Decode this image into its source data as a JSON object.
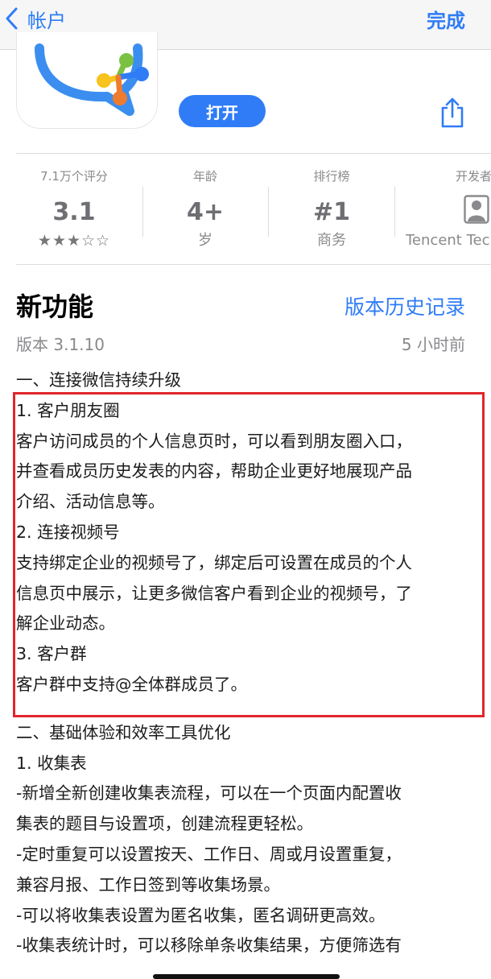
{
  "nav": {
    "back_label": "帐户",
    "done_label": "完成"
  },
  "app": {
    "open_label": "打开"
  },
  "info": {
    "ratings": {
      "label": "7.1万个评分",
      "value": "3.1",
      "stars": "★★★☆☆"
    },
    "age": {
      "label": "年龄",
      "value": "4+",
      "sub": "岁"
    },
    "chart": {
      "label": "排行榜",
      "value": "#1",
      "sub": "商务"
    },
    "developer": {
      "label": "开发者",
      "sub": "Tencent Technology"
    }
  },
  "whats_new": {
    "title": "新功能",
    "history_link": "版本历史记录",
    "version": "版本 3.1.10",
    "time_ago": "5 小时前",
    "lines_part1": [
      "一、连接微信持续升级",
      "1. 客户朋友圈",
      "客户访问成员的个人信息页时，可以看到朋友圈入口，",
      "并查看成员历史发表的内容，帮助企业更好地展现产品",
      "介绍、活动信息等。",
      "2. 连接视频号",
      "支持绑定企业的视频号了，绑定后可设置在成员的个人",
      "信息页中展示，让更多微信客户看到企业的视频号，了",
      "解企业动态。",
      "3. 客户群",
      "客户群中支持@全体群成员了。"
    ],
    "lines_part2": [
      "二、基础体验和效率工具优化",
      "1. 收集表",
      "-新增全新创建收集表流程，可以在一个页面内配置收",
      "集表的题目与设置项，创建流程更轻松。",
      "-定时重复可以设置按天、工作日、周或月设置重复，",
      "兼容月报、工作日签到等收集场景。",
      "-可以将收集表设置为匿名收集，匿名调研更高效。",
      "-收集表统计时，可以移除单条收集结果，方便筛选有"
    ]
  }
}
